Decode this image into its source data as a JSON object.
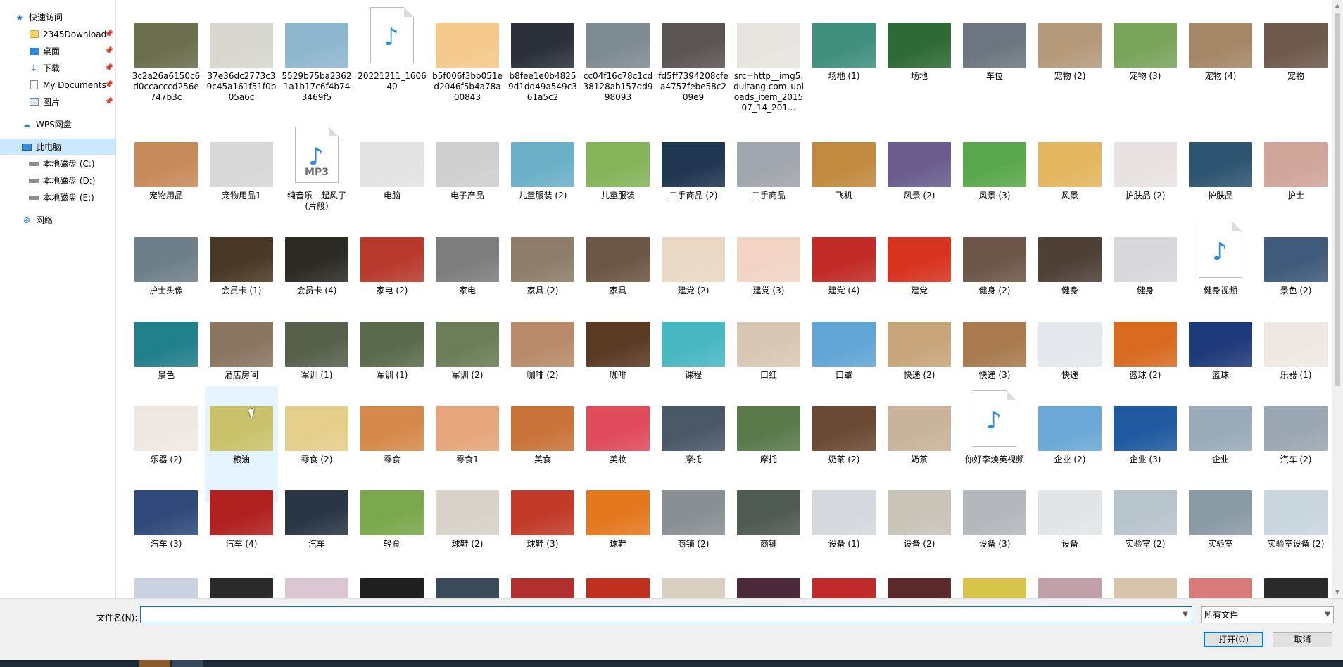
{
  "navigation": {
    "quick_access": "快速访问",
    "pinned": [
      {
        "label": "2345Download",
        "icon": "folder-icon"
      },
      {
        "label": "桌面",
        "icon": "desktop-icon"
      },
      {
        "label": "下载",
        "icon": "download-icon"
      },
      {
        "label": "My Documents",
        "icon": "document-icon"
      },
      {
        "label": "图片",
        "icon": "pictures-icon"
      }
    ],
    "wps_cloud": "WPS网盘",
    "this_pc": "此电脑",
    "drives": [
      {
        "label": "本地磁盘 (C:)"
      },
      {
        "label": "本地磁盘 (D:)"
      },
      {
        "label": "本地磁盘 (E:)"
      }
    ],
    "network": "网络"
  },
  "files": [
    {
      "name": "3c2a26a6150c6d0ccacccd256e747b3c",
      "color": "#6b6d4d"
    },
    {
      "name": "37e36dc2773c39c45a161f51f0b05a6c",
      "color": "#d9d6cf"
    },
    {
      "name": "5529b75ba23621a1b17c6f4b743469f5",
      "color": "#8fb6cf"
    },
    {
      "name": "20221211_160640",
      "type": "video"
    },
    {
      "name": "b5f006f3bb051ed2046f5b4a78a00843",
      "color": "#f4c98a"
    },
    {
      "name": "b8fee1e0b48259d1dd49a549c361a5c2",
      "color": "#2a2f3a"
    },
    {
      "name": "cc04f16c78c1cd38128ab157dd998093",
      "color": "#7f8b92"
    },
    {
      "name": "fd5ff7394208cfea4757febe58c209e9",
      "color": "#5a5552"
    },
    {
      "name": "src=http__img5.duitang.com_uploads_item_201507_14_201...",
      "color": "#e8e4df"
    },
    {
      "name": "场地 (1)",
      "color": "#3f8f7d"
    },
    {
      "name": "场地",
      "color": "#2e6a35"
    },
    {
      "name": "车位",
      "color": "#6d7680"
    },
    {
      "name": "宠物 (2)",
      "color": "#b49a7a"
    },
    {
      "name": "宠物 (3)",
      "color": "#7aa45b"
    },
    {
      "name": "宠物 (4)",
      "color": "#a48766"
    },
    {
      "name": "宠物",
      "color": "#6e5a4c"
    },
    {
      "name": "宠物用品",
      "color": "#c98a5a"
    },
    {
      "name": "宠物用品1",
      "color": "#d7d7d7"
    },
    {
      "name": "纯音乐 - 起风了 (片段)",
      "type": "mp3"
    },
    {
      "name": "电脑",
      "color": "#e3e3e3"
    },
    {
      "name": "电子产品",
      "color": "#cfcfcf"
    },
    {
      "name": "儿童服装 (2)",
      "color": "#6bb0c8"
    },
    {
      "name": "儿童服装",
      "color": "#84b45a"
    },
    {
      "name": "二手商品 (2)",
      "color": "#1f3550"
    },
    {
      "name": "二手商品",
      "color": "#a0a6ad"
    },
    {
      "name": "飞机",
      "color": "#c08a3e"
    },
    {
      "name": "风景 (2)",
      "color": "#6a5d8d"
    },
    {
      "name": "风景 (3)",
      "color": "#5aa84d"
    },
    {
      "name": "风景",
      "color": "#e3b65f"
    },
    {
      "name": "护肤品 (2)",
      "color": "#e8e2e2"
    },
    {
      "name": "护肤品",
      "color": "#2e5570"
    },
    {
      "name": "护士",
      "color": "#d0a59a"
    },
    {
      "name": "护士头像",
      "color": "#6f7f8a"
    },
    {
      "name": "会员卡 (1)",
      "color": "#4a3826"
    },
    {
      "name": "会员卡 (4)",
      "color": "#2c2a22"
    },
    {
      "name": "家电 (2)",
      "color": "#b83a2c"
    },
    {
      "name": "家电",
      "color": "#7d7d7d"
    },
    {
      "name": "家具 (2)",
      "color": "#8d7d6a"
    },
    {
      "name": "家具",
      "color": "#6b5645"
    },
    {
      "name": "建党 (2)",
      "color": "#e9d8c3"
    },
    {
      "name": "建党 (3)",
      "color": "#f1d4c4"
    },
    {
      "name": "建党 (4)",
      "color": "#c22a25"
    },
    {
      "name": "建党",
      "color": "#d8331f"
    },
    {
      "name": "健身 (2)",
      "color": "#6d5648"
    },
    {
      "name": "健身",
      "color": "#4f4037"
    },
    {
      "name": "健身",
      "color": "#d8d8dc"
    },
    {
      "name": "健身视频",
      "type": "video"
    },
    {
      "name": "景色 (2)",
      "color": "#3f5a7a"
    },
    {
      "name": "景色",
      "color": "#1f7f8a"
    },
    {
      "name": "酒店房间",
      "color": "#8a7560"
    },
    {
      "name": "军训 (1)",
      "color": "#56604a"
    },
    {
      "name": "军训 (1)",
      "color": "#5a6a4a"
    },
    {
      "name": "军训 (2)",
      "color": "#6b7d58"
    },
    {
      "name": "咖啡 (2)",
      "color": "#b88a6a"
    },
    {
      "name": "咖啡",
      "color": "#5b3a22"
    },
    {
      "name": "课程",
      "color": "#49b7c2"
    },
    {
      "name": "口红",
      "color": "#d8c7b3"
    },
    {
      "name": "口罩",
      "color": "#5fa5d6"
    },
    {
      "name": "快递 (2)",
      "color": "#c7a57a"
    },
    {
      "name": "快递 (3)",
      "color": "#a87a4d"
    },
    {
      "name": "快递",
      "color": "#e4e8ec"
    },
    {
      "name": "篮球 (2)",
      "color": "#d86a1f"
    },
    {
      "name": "篮球",
      "color": "#1f3a7a"
    },
    {
      "name": "乐器 (1)",
      "color": "#efe8e2"
    },
    {
      "name": "乐器 (2)",
      "color": "#efe8e2"
    },
    {
      "name": "粮油",
      "color": "#c9c26a"
    },
    {
      "name": "零食 (2)",
      "color": "#e4cf8a"
    },
    {
      "name": "零食",
      "color": "#d6894a"
    },
    {
      "name": "零食1",
      "color": "#e6a57a"
    },
    {
      "name": "美食",
      "color": "#c9733a"
    },
    {
      "name": "美妆",
      "color": "#e04a5a"
    },
    {
      "name": "摩托",
      "color": "#4a5866"
    },
    {
      "name": "摩托",
      "color": "#5a7a4a"
    },
    {
      "name": "奶茶 (2)",
      "color": "#6a4a32"
    },
    {
      "name": "奶茶",
      "color": "#c9b39a"
    },
    {
      "name": "你好李焕英视频",
      "type": "video"
    },
    {
      "name": "企业 (2)",
      "color": "#6aa8d6"
    },
    {
      "name": "企业 (3)",
      "color": "#1f5aa0"
    },
    {
      "name": "企业",
      "color": "#9aaab8"
    },
    {
      "name": "汽车 (2)",
      "color": "#9aa6b2"
    },
    {
      "name": "汽车 (3)",
      "color": "#2f4a7a"
    },
    {
      "name": "汽车 (4)",
      "color": "#b0201f"
    },
    {
      "name": "汽车",
      "color": "#2a3644"
    },
    {
      "name": "轻食",
      "color": "#7aa84a"
    },
    {
      "name": "球鞋 (2)",
      "color": "#d8d2c8"
    },
    {
      "name": "球鞋 (3)",
      "color": "#c23a2a"
    },
    {
      "name": "球鞋",
      "color": "#e4781f"
    },
    {
      "name": "商铺 (2)",
      "color": "#8a8f94"
    },
    {
      "name": "商铺",
      "color": "#4f5a52"
    },
    {
      "name": "设备 (1)",
      "color": "#d4d8dc"
    },
    {
      "name": "设备 (2)",
      "color": "#c9c4b8"
    },
    {
      "name": "设备 (3)",
      "color": "#b4b8bc"
    },
    {
      "name": "设备",
      "color": "#e2e4e6"
    },
    {
      "name": "实验室 (2)",
      "color": "#b8c4cc"
    },
    {
      "name": "实验室",
      "color": "#8a9aa4"
    },
    {
      "name": "实验室设备 (2)",
      "color": "#c9d6de"
    },
    {
      "name": "",
      "color": "#c8d2e0"
    },
    {
      "name": "",
      "color": "#2a2a2a"
    },
    {
      "name": "",
      "color": "#d9c6d2"
    },
    {
      "name": "",
      "color": "#1f1f1f"
    },
    {
      "name": "",
      "color": "#3a4a5a"
    },
    {
      "name": "",
      "color": "#b03030"
    },
    {
      "name": "",
      "color": "#c0301f"
    },
    {
      "name": "",
      "color": "#d8cfc0"
    },
    {
      "name": "",
      "color": "#4a2a3a"
    },
    {
      "name": "",
      "color": "#c02a2a"
    },
    {
      "name": "",
      "color": "#5a2a2a"
    },
    {
      "name": "",
      "color": "#d8c44a"
    },
    {
      "name": "",
      "color": "#c0a0a8"
    },
    {
      "name": "",
      "color": "#d8c4a8"
    },
    {
      "name": "",
      "color": "#d87a7a"
    },
    {
      "name": "",
      "color": "#2a2a2a"
    }
  ],
  "selected_file": "粮油",
  "footer": {
    "filename_label": "文件名(N):",
    "filename_value": "",
    "filter": "所有文件",
    "open_button": "打开(O)",
    "cancel_button": "取消"
  }
}
